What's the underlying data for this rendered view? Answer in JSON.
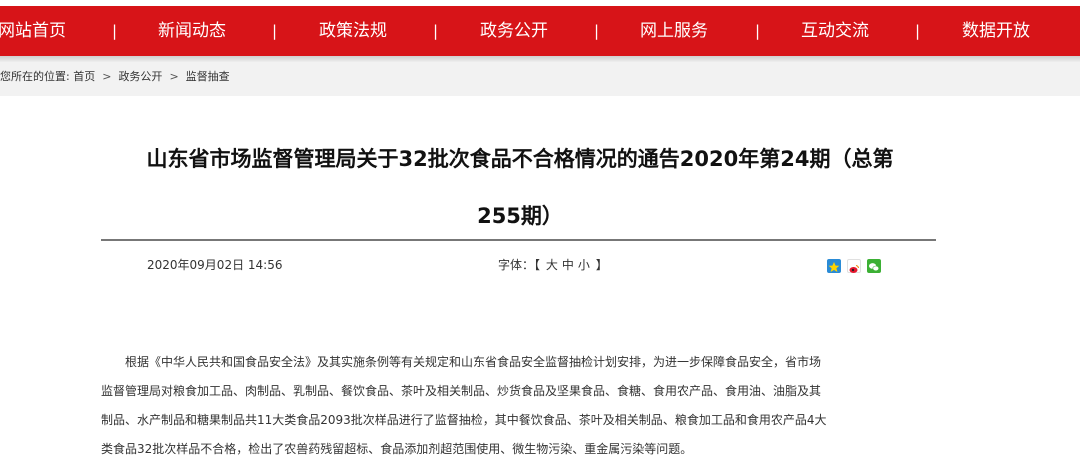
{
  "nav": {
    "items": [
      {
        "label": "网站首页"
      },
      {
        "label": "新闻动态"
      },
      {
        "label": "政策法规"
      },
      {
        "label": "政务公开"
      },
      {
        "label": "网上服务"
      },
      {
        "label": "互动交流"
      },
      {
        "label": "数据开放"
      }
    ],
    "separator": "|"
  },
  "breadcrumb": {
    "prefix": "您所在的位置:",
    "items": [
      "首页",
      "政务公开",
      "监督抽查"
    ],
    "separator": ">"
  },
  "article": {
    "title_line1": "山东省市场监督管理局关于32批次食品不合格情况的通告2020年第24期（总第",
    "title_line2": "255期）",
    "date": "2020年09月02日 14:56",
    "font_label": "字体：",
    "font_open": "【",
    "font_close": "】",
    "font_options": [
      "大",
      "中",
      "小"
    ],
    "share_icons": [
      "qzone-icon",
      "weibo-icon",
      "wechat-icon"
    ],
    "colors": {
      "nav_bg": "#d71418",
      "qzone": "#2a8bd6",
      "weibo": "#e6162d",
      "wechat": "#3cb034"
    },
    "body_lines": [
      "根据《中华人民共和国食品安全法》及其实施条例等有关规定和山东省食品安全监督抽检计划安排，为进一步保障食品安全，省市场",
      "监督管理局对粮食加工品、肉制品、乳制品、餐饮食品、茶叶及相关制品、炒货食品及坚果食品、食糖、食用农产品、食用油、油脂及其",
      "制品、水产制品和糖果制品共11大类食品2093批次样品进行了监督抽检，其中餐饮食品、茶叶及相关制品、粮食加工品和食用农产品4大",
      "类食品32批次样品不合格，检出了农兽药残留超标、食品添加剂超范围使用、微生物污染、重金属污染等问题。"
    ]
  }
}
